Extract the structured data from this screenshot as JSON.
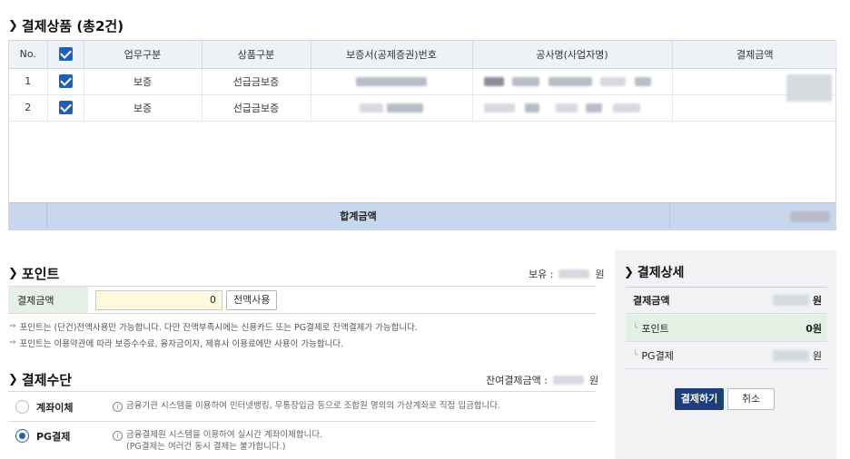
{
  "products": {
    "title": "결제상품 (총2건)",
    "columns": [
      "No.",
      "",
      "업무구분",
      "상품구분",
      "보증서(공제증권)번호",
      "공사명(사업자명)",
      "결제금액"
    ],
    "rows": [
      {
        "no": "1",
        "biz": "보증",
        "product": "선급금보증"
      },
      {
        "no": "2",
        "biz": "보증",
        "product": "선급금보증"
      }
    ],
    "total_label": "합계금액"
  },
  "points": {
    "title": "포인트",
    "holding_label": "보유 :",
    "holding_unit": "원",
    "amount_label": "결제금액",
    "amount_value": "0",
    "use_all_button": "전액사용",
    "notes": [
      "포인트는 (단건)전액사용만 가능합니다. 다만 잔액부족시에는 신용카드 또는 PG결제로 잔액결제가 가능합니다.",
      "포인트는 이용약관에 따라 보증수수료, 융자금이자, 제휴사 이용료에만 사용이 가능합니다."
    ]
  },
  "method": {
    "title": "결제수단",
    "remain_label": "잔여결제금액 :",
    "remain_unit": "원",
    "options": [
      {
        "name": "계좌이체",
        "desc1": "금융기관 시스템을 이용하여 인터넷뱅킹, 무통장입금 등으로 조합원 명의의 가상계좌로 직접 입금합니다.",
        "desc2": "",
        "selected": false
      },
      {
        "name": "PG결제",
        "desc1": "금융결제원 시스템을 이용하여 실시간 계좌이체합니다.",
        "desc2": "(PG결제는 여러건 동시 결제는 불가합니다.)",
        "selected": true
      }
    ]
  },
  "detail": {
    "title": "결제상세",
    "amount_label": "결제금액",
    "amount_unit": "원",
    "point_label": "포인트",
    "point_value": "0원",
    "pg_label": "PG결제",
    "pg_unit": "원",
    "pay_button": "결제하기",
    "cancel_button": "취소"
  },
  "colors": {
    "accent": "#1f5fb7",
    "total_row": "#c9d7ee",
    "input_bg": "#fff9dd",
    "pay_button": "#1b3f7a"
  }
}
